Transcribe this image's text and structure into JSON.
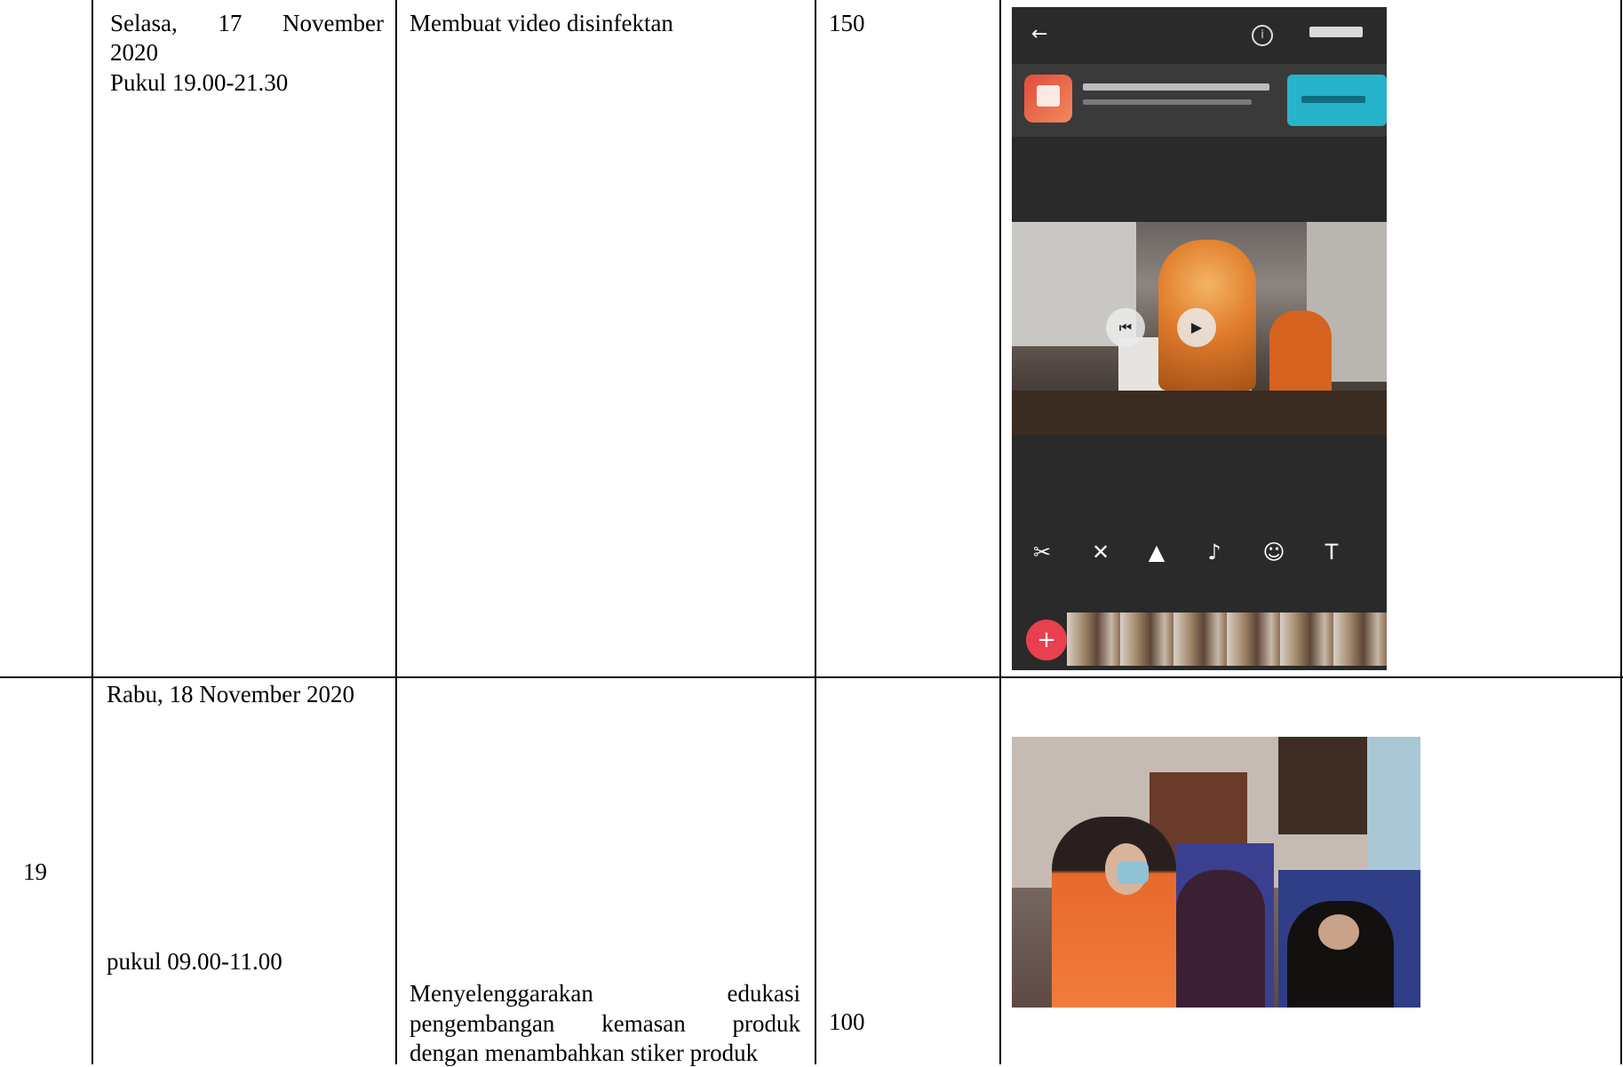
{
  "rows": [
    {
      "no": "",
      "date_line1_words": [
        "Selasa,",
        "17",
        "November"
      ],
      "date_line2": "2020",
      "time": "Pukul 19.00-21.30",
      "activity_line1": "Membuat video disinfektan",
      "duration": "150",
      "documentation": "video-editor-screenshot"
    },
    {
      "no": "19",
      "date": "Rabu, 18 November 2020",
      "time": "pukul 09.00-11.00",
      "activity_line1_words": [
        "Menyelenggarakan",
        "edukasi"
      ],
      "activity_line2_words": [
        "pengembangan",
        "kemasan",
        "produk"
      ],
      "activity_line3": "dengan menambahkan stiker produk",
      "duration": "100",
      "documentation": "event-photo"
    }
  ],
  "phone_ui": {
    "back_icon": "arrow-left-icon",
    "info_icon": "info-icon",
    "tool_icons": [
      "scissors-icon",
      "trim-icon",
      "filter-icon",
      "music-icon",
      "sticker-icon",
      "text-icon"
    ],
    "tool_glyphs": [
      "✂",
      "✕",
      "▲",
      "♪",
      "☺",
      "T"
    ],
    "add_glyph": "+",
    "ad_cta_color": "#27b3c9",
    "add_button_color": "#e8404f"
  }
}
